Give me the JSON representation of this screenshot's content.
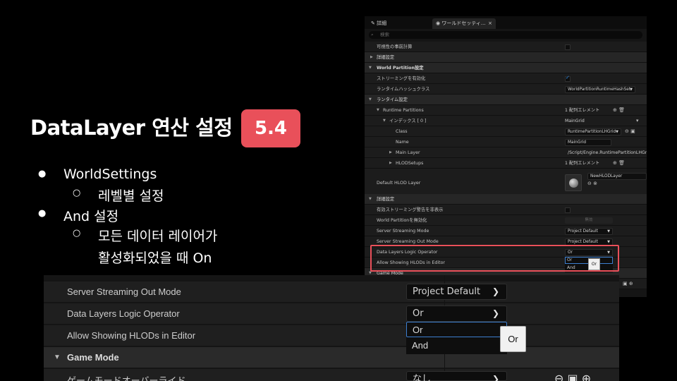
{
  "slide": {
    "title": "DataLayer 연산 설정",
    "version": "5.4",
    "bullets": [
      {
        "marker": "●",
        "text": "WorldSettings"
      },
      {
        "marker": "○",
        "text": "레벨별 설정"
      },
      {
        "marker": "●",
        "text": "And 설정"
      },
      {
        "marker": "○",
        "text": "모든 데이터 레이어가"
      },
      {
        "marker": "",
        "text": "활성화되었을 때 On"
      }
    ]
  },
  "panel": {
    "tab_details": "詳細",
    "tab_world_settings": "ワールドセッティ...",
    "tab_close": "×",
    "search_placeholder": "検索",
    "rows": {
      "visibility_precompute": "可視性の事前計算",
      "advanced": "詳細設定",
      "world_partition_settings": "World Partition設定",
      "enable_streaming": "ストリーミングを有効化",
      "runtime_hash_class": "ランタイムハッシュクラス",
      "runtime_hash_value": "WorldPartitionRuntimeHashSet",
      "runtime_settings": "ランタイム設定",
      "runtime_partitions": "Runtime Partitions",
      "runtime_partitions_value": "1 配列エレメント",
      "index0": "インデックス [ 0 ]",
      "index0_value": "MainGrid",
      "class": "Class",
      "class_value": "RuntimePartitionLHGrid",
      "name": "Name",
      "name_value": "MainGrid",
      "main_layer": "Main Layer",
      "main_layer_value": "/Script/Engine.RuntimePartitionLHGrid/G",
      "hlod_setups": "HLODSetups",
      "hlod_setups_value": "1 配列エレメント",
      "default_hlod_layer": "Default HLOD Layer",
      "default_hlod_value": "NewHLODLayer",
      "advanced2": "詳細設定",
      "streaming_warning": "有効ストリーミング警告を非表示",
      "disable_wp": "World Partitionを無効化",
      "disable_wp_button": "無効",
      "server_streaming_mode": "Server Streaming Mode",
      "server_streaming_mode_value": "Project Default",
      "server_streaming_out_mode": "Server Streaming Out Mode",
      "server_streaming_out_mode_value": "Project Default",
      "data_layers_logic": "Data Layers Logic Operator",
      "data_layers_logic_value": "Or",
      "allow_hlods": "Allow Showing HLODs in Editor",
      "option_or": "Or",
      "option_and": "And",
      "tooltip_or": "Or",
      "game_mode": "Game Mode"
    }
  },
  "zoom": {
    "server_streaming_out_mode": "Server Streaming Out Mode",
    "server_streaming_out_mode_value": "Project Default",
    "data_layers_logic": "Data Layers Logic Operator",
    "data_layers_logic_value": "Or",
    "allow_hlods": "Allow Showing HLODs in Editor",
    "option_or": "Or",
    "option_and": "And",
    "tooltip_or": "Or",
    "game_mode": "Game Mode",
    "game_mode_override": "ゲームモードオーバーライド",
    "game_mode_override_value": "なし"
  },
  "colors": {
    "accent": "#e9505a",
    "select": "#3d7fd0"
  }
}
